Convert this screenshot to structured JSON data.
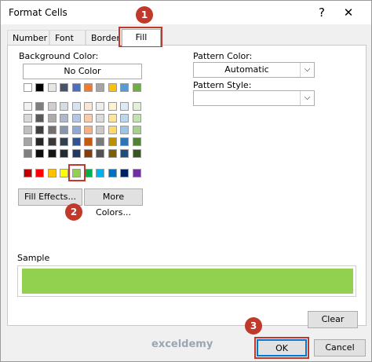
{
  "dialog": {
    "title": "Format Cells",
    "help_label": "?",
    "close_label": "✕"
  },
  "tabs": [
    {
      "label": "Number"
    },
    {
      "label": "Font"
    },
    {
      "label": "Border"
    },
    {
      "label": "Fill",
      "active": true
    }
  ],
  "fill": {
    "background_color_label": "Background Color:",
    "no_color_label": "No Color",
    "pattern_color_label": "Pattern Color:",
    "pattern_color_value": "Automatic",
    "pattern_style_label": "Pattern Style:",
    "pattern_style_value": "",
    "fill_effects_label": "Fill Effects...",
    "more_colors_label": "More Colors...",
    "sample_label": "Sample",
    "clear_label": "Clear",
    "selected_color": "#92D050"
  },
  "palette": {
    "theme_top": [
      "#FFFFFF",
      "#000000",
      "#E7E6E6",
      "#44546A",
      "#4472C4",
      "#ED7D31",
      "#A5A5A5",
      "#FFC000",
      "#5B9BD5",
      "#70AD47"
    ],
    "theme_rows": [
      [
        "#F2F2F2",
        "#7F7F7F",
        "#D0CECE",
        "#D6DCE4",
        "#D9E2F3",
        "#FBE5D5",
        "#EDEDED",
        "#FFF2CC",
        "#DEEBF6",
        "#E2EFD9"
      ],
      [
        "#D8D8D8",
        "#595959",
        "#AEABAB",
        "#ADB9CA",
        "#B4C6E7",
        "#F7CBAC",
        "#DBDBDB",
        "#FEE599",
        "#BDD7EE",
        "#C5E0B3"
      ],
      [
        "#BFBFBF",
        "#3F3F3F",
        "#757070",
        "#8496B0",
        "#8EAADB",
        "#F4B183",
        "#C9C9C9",
        "#FFD966",
        "#9DC3E6",
        "#A8D08D"
      ],
      [
        "#A5A5A5",
        "#262626",
        "#3A3838",
        "#323F4F",
        "#2F5496",
        "#C55A11",
        "#7B7B7B",
        "#BF8F00",
        "#2E75B5",
        "#538135"
      ],
      [
        "#7F7F7F",
        "#0C0C0C",
        "#171616",
        "#222A35",
        "#1F3864",
        "#833C0B",
        "#525252",
        "#7F6000",
        "#1E4E79",
        "#375623"
      ]
    ],
    "standard": [
      "#C00000",
      "#FF0000",
      "#FFC000",
      "#FFFF00",
      "#92D050",
      "#00B050",
      "#00B0F0",
      "#0070C0",
      "#002060",
      "#7030A0"
    ]
  },
  "footer": {
    "ok_label": "OK",
    "cancel_label": "Cancel"
  },
  "annotations": {
    "badge1": "1",
    "badge2": "2",
    "badge3": "3",
    "color": "#C0392B"
  },
  "watermark": {
    "text": "exceldemy"
  }
}
